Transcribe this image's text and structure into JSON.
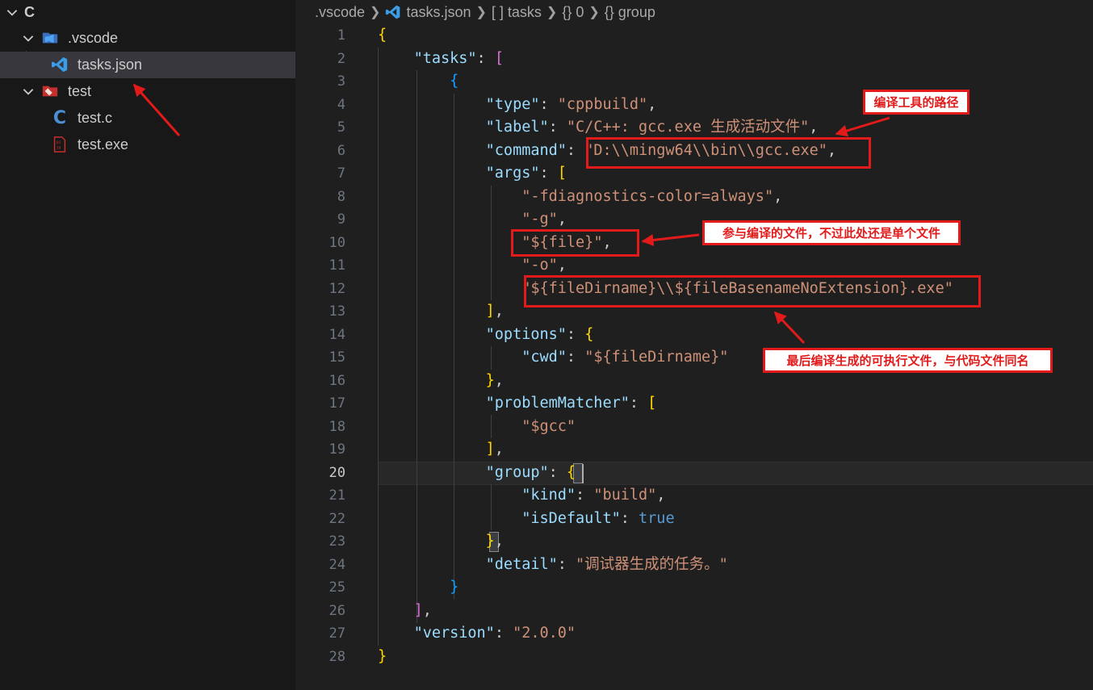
{
  "sidebar": {
    "root_label": "C",
    "items": [
      {
        "label": ".vscode",
        "icon": "vscode-folder-icon"
      },
      {
        "label": "tasks.json",
        "icon": "vscode-json-icon"
      },
      {
        "label": "test",
        "icon": "test-folder-icon"
      },
      {
        "label": "test.c",
        "icon": "c-file-icon"
      },
      {
        "label": "test.exe",
        "icon": "binary-file-icon"
      }
    ]
  },
  "breadcrumb": [
    ".vscode",
    "tasks.json",
    "[ ] tasks",
    "{} 0",
    "{} group"
  ],
  "editor": {
    "active_line": "20",
    "line_numbers": [
      "1",
      "2",
      "3",
      "4",
      "5",
      "6",
      "7",
      "8",
      "9",
      "10",
      "11",
      "12",
      "13",
      "14",
      "15",
      "16",
      "17",
      "18",
      "19",
      "20",
      "21",
      "22",
      "23",
      "24",
      "25",
      "26",
      "27",
      "28"
    ],
    "code": {
      "tasks_key": "\"tasks\"",
      "type_key": "\"type\"",
      "type_val": "\"cppbuild\"",
      "label_key": "\"label\"",
      "label_val": "\"C/C++: gcc.exe 生成活动文件\"",
      "command_key": "\"command\"",
      "command_val": "\"D:\\\\mingw64\\\\bin\\\\gcc.exe\"",
      "args_key": "\"args\"",
      "arg1": "\"-fdiagnostics-color=always\"",
      "arg2": "\"-g\"",
      "arg3": "\"${file}\"",
      "arg4": "\"-o\"",
      "arg5": "\"${fileDirname}\\\\${fileBasenameNoExtension}.exe\"",
      "options_key": "\"options\"",
      "cwd_key": "\"cwd\"",
      "cwd_val": "\"${fileDirname}\"",
      "pm_key": "\"problemMatcher\"",
      "pm_val": "\"$gcc\"",
      "group_key": "\"group\"",
      "kind_key": "\"kind\"",
      "kind_val": "\"build\"",
      "isdefault_key": "\"isDefault\"",
      "isdefault_val": "true",
      "detail_key": "\"detail\"",
      "detail_val": "\"调试器生成的任务。\"",
      "version_key": "\"version\"",
      "version_val": "\"2.0.0\""
    }
  },
  "annotations": {
    "compiler_path": "编译工具的路径",
    "input_file": "参与编译的文件，不过此处还是单个文件",
    "output_file": "最后编译生成的可执行文件，与代码文件同名"
  },
  "colors": {
    "annotation_red": "#e21a1a",
    "json_key": "#9cdcfe",
    "json_string": "#ce9178",
    "bracket_gold": "#ffd700",
    "bracket_purple": "#da70d6",
    "bracket_blue": "#179fff"
  }
}
